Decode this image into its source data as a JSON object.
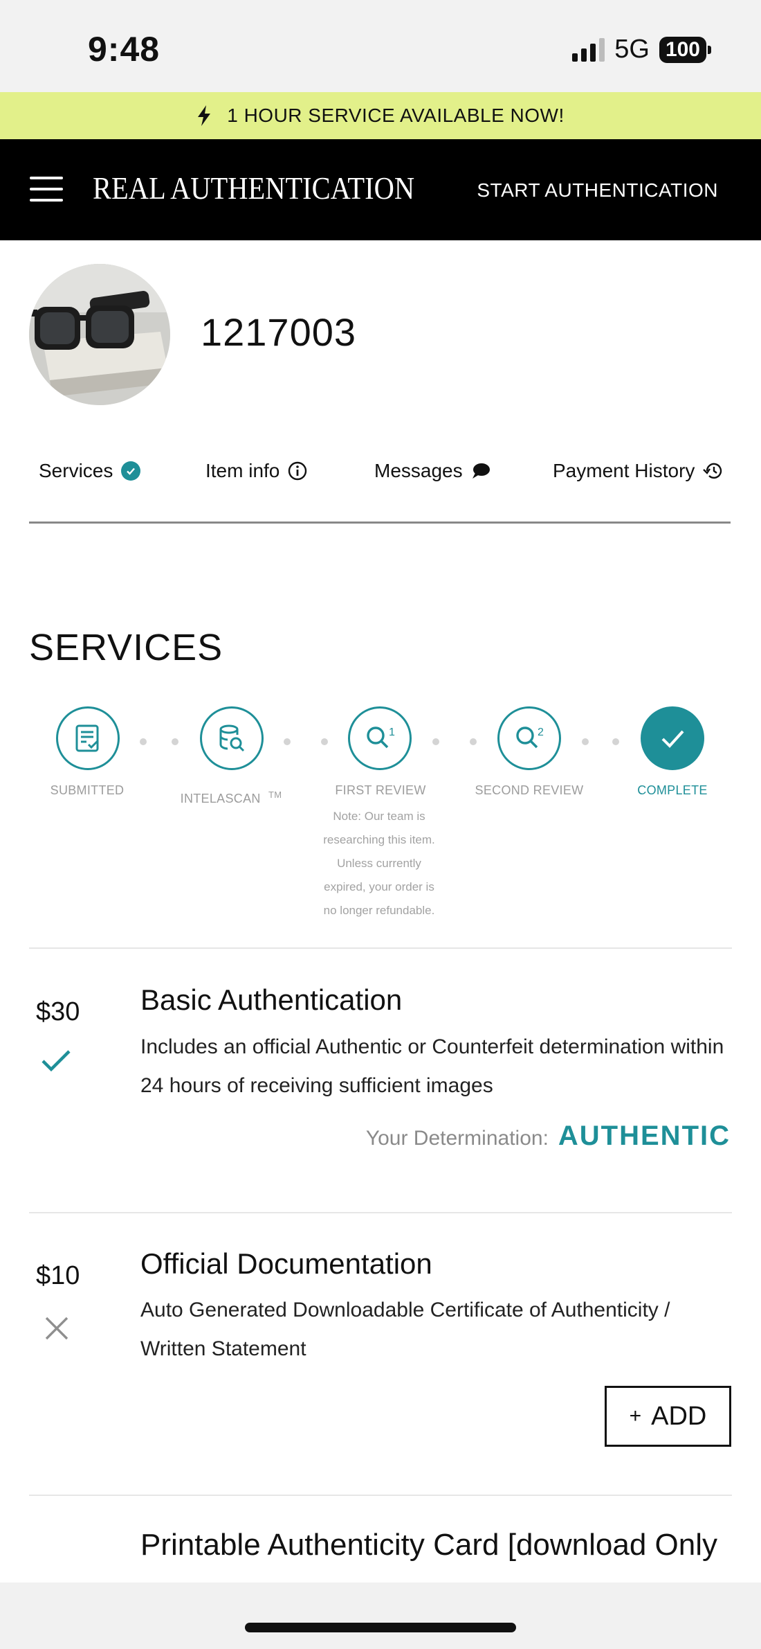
{
  "status_bar": {
    "time": "9:48",
    "network": "5G",
    "battery": "100"
  },
  "banner": {
    "text": "1 HOUR SERVICE AVAILABLE NOW!"
  },
  "header": {
    "brand": "REAL AUTHENTICATION",
    "cta": "START AUTHENTICATION"
  },
  "item": {
    "id": "1217003"
  },
  "tabs": [
    {
      "label": "Services"
    },
    {
      "label": "Item info"
    },
    {
      "label": "Messages"
    },
    {
      "label": "Payment History"
    }
  ],
  "services": {
    "title": "SERVICES",
    "steps": [
      {
        "label": "SUBMITTED"
      },
      {
        "label": "INTELASCAN",
        "mark": "TM"
      },
      {
        "label": "FIRST REVIEW"
      },
      {
        "label": "SECOND REVIEW"
      },
      {
        "label": "COMPLETE"
      }
    ],
    "note_lines": [
      "Note: Our team is",
      "researching this item.",
      "Unless currently",
      "expired, your order is",
      "no longer refundable."
    ],
    "items": [
      {
        "price": "$30",
        "title": "Basic Authentication",
        "description": "Includes an official Authentic or Counterfeit determination within 24 hours of receiving sufficient images",
        "status": "selected",
        "determination_label": "Your Determination:",
        "determination_value": "AUTHENTIC"
      },
      {
        "price": "$10",
        "title": "Official Documentation",
        "description": "Auto Generated Downloadable Certificate of Authenticity / Written Statement",
        "status": "not-selected",
        "add_label": "ADD",
        "add_prefix": "+"
      },
      {
        "title": "Printable Authenticity Card [download Only"
      }
    ]
  },
  "colors": {
    "accent": "#1e8f98",
    "banner": "#e2f08a",
    "header": "#000000"
  }
}
